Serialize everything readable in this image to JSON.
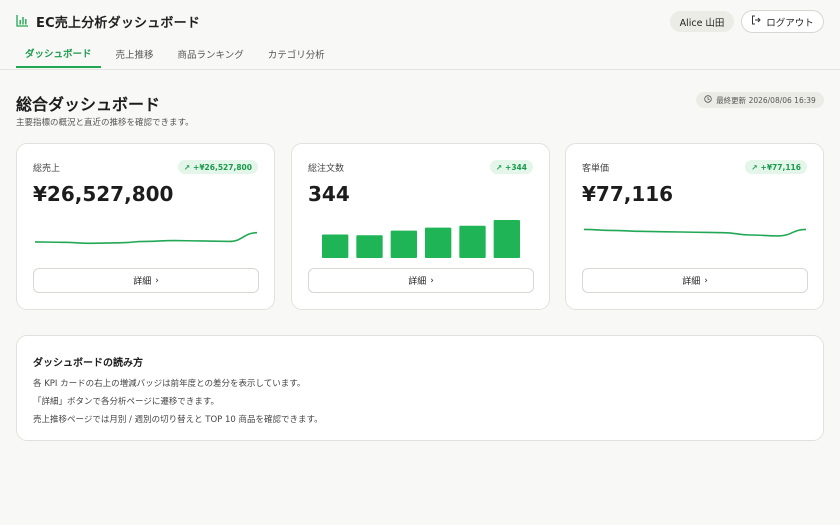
{
  "app": {
    "title": "EC売上分析ダッシュボード",
    "icon": "bar-chart-icon",
    "accent": "#22a855"
  },
  "user": {
    "name": "Alice 山田"
  },
  "header": {
    "logout_label": "ログアウト"
  },
  "tabs": [
    {
      "label": "ダッシュボード",
      "active": true
    },
    {
      "label": "売上推移",
      "active": false
    },
    {
      "label": "商品ランキング",
      "active": false
    },
    {
      "label": "カテゴリ分析",
      "active": false
    }
  ],
  "page": {
    "title": "総合ダッシュボード",
    "subtitle": "主要指標の概況と直近の推移を確認できます。",
    "updated": "最終更新 2026/08/06 16:39"
  },
  "cards": [
    {
      "label": "総売上",
      "badge": "+¥26,527,800",
      "value": "¥26,527,800",
      "chart": "line",
      "trend": [
        0.35,
        0.34,
        0.32,
        0.33,
        0.36,
        0.38,
        0.37,
        0.36,
        0.55
      ],
      "button": "詳細"
    },
    {
      "label": "総注文数",
      "badge": "+344",
      "value": "344",
      "chart": "bar",
      "trend": [
        0.62,
        0.6,
        0.72,
        0.8,
        0.85,
        1.0
      ],
      "button": "詳細"
    },
    {
      "label": "客単価",
      "badge": "+¥77,116",
      "value": "¥77,116",
      "chart": "line",
      "trend": [
        0.62,
        0.6,
        0.58,
        0.57,
        0.56,
        0.55,
        0.5,
        0.48,
        0.62
      ],
      "button": "詳細"
    }
  ],
  "guide": {
    "title": "ダッシュボードの読み方",
    "lines": [
      "各 KPI カードの右上の増減バッジは前年度との差分を表示しています。",
      "「詳細」ボタンで各分析ページに遷移できます。",
      "売上推移ページでは月別 / 週別の切り替えと TOP 10 商品を確認できます。"
    ]
  }
}
